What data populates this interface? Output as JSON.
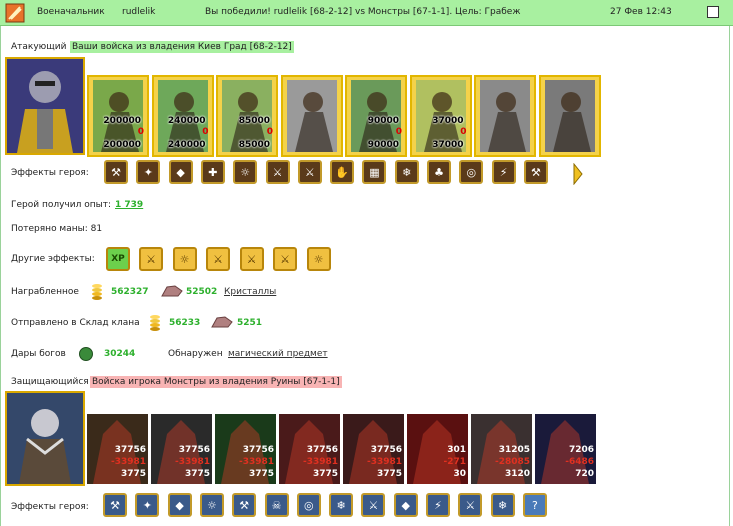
{
  "header": {
    "role": "Военачальник",
    "user": "rudlelik",
    "message": "Вы победили! rudlelik [68-2-12] vs Монстры [67-1-1]. Цель: Грабеж",
    "date": "27 Фев 12:43"
  },
  "attacker": {
    "label": "Атакующий",
    "banner": "Ваши войска из владения Киев Град [68-2-12]",
    "units": [
      {
        "name": "unit-1",
        "count": "200000",
        "after": "200000",
        "loss": "0"
      },
      {
        "name": "unit-2",
        "count": "240000",
        "after": "240000",
        "loss": "0"
      },
      {
        "name": "unit-3",
        "count": "85000",
        "after": "85000",
        "loss": "0"
      },
      {
        "name": "unit-4",
        "count": "",
        "after": "",
        "loss": ""
      },
      {
        "name": "unit-5",
        "count": "90000",
        "after": "90000",
        "loss": "0"
      },
      {
        "name": "unit-6",
        "count": "37000",
        "after": "37000",
        "loss": "0"
      },
      {
        "name": "unit-7",
        "count": "",
        "after": "",
        "loss": ""
      },
      {
        "name": "unit-8",
        "count": "",
        "after": "",
        "loss": ""
      }
    ],
    "hero_effects_label": "Эффекты героя:",
    "exp_label": "Герой получил опыт:",
    "exp_value": "1 739",
    "mana_text": "Потеряно маны: 81",
    "other_effects_label": "Другие эффекты:",
    "other_effects_first": "XP",
    "loot_label": "Награбленное",
    "loot_gold": "562327",
    "loot_crystal": "52502",
    "loot_crystal_name": "Кристаллы",
    "clan_label": "Отправлено в Склад клана",
    "clan_gold": "56233",
    "clan_crystal": "5251",
    "gifts_label": "Дары богов",
    "gifts_value": "30244",
    "found_label": "Обнаружен",
    "found_link": "магический предмет"
  },
  "defender": {
    "label": "Защищающийся",
    "banner": "Войска игрока Монстры из владения Руины [67-1-1]",
    "units": [
      {
        "a": "37756",
        "b": "-33981",
        "c": "3775"
      },
      {
        "a": "37756",
        "b": "-33981",
        "c": "3775"
      },
      {
        "a": "37756",
        "b": "-33981",
        "c": "3775"
      },
      {
        "a": "37756",
        "b": "-33981",
        "c": "3775"
      },
      {
        "a": "37756",
        "b": "-33981",
        "c": "3775"
      },
      {
        "a": "301",
        "b": "-271",
        "c": "30"
      },
      {
        "a": "31205",
        "b": "-28085",
        "c": "3120"
      },
      {
        "a": "7206",
        "b": "-6486",
        "c": "720"
      }
    ],
    "hero_effects_label": "Эффекты героя:",
    "last_effect": "?"
  }
}
